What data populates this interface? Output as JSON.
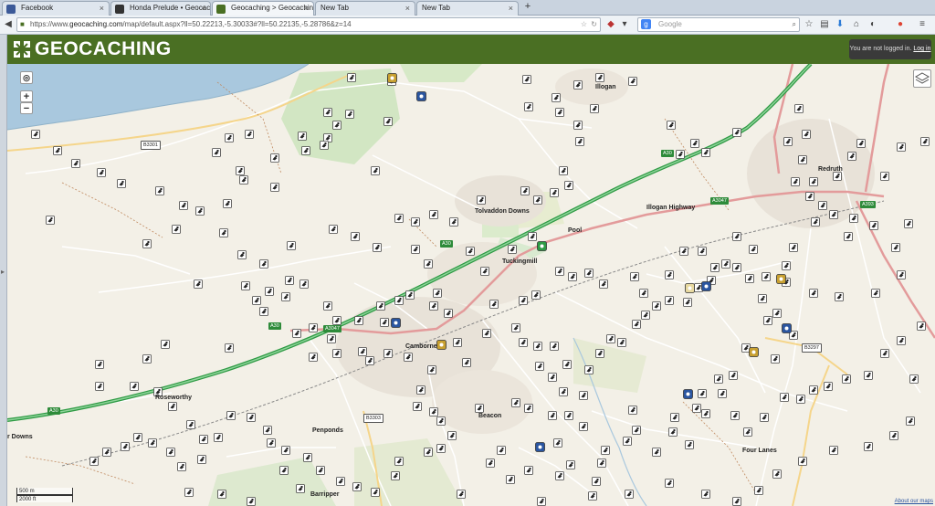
{
  "tabs": [
    {
      "label": "Facebook",
      "favicon_color": "#3b5998"
    },
    {
      "label": "Honda Prelude • Geocachi...",
      "favicon_color": "#333333"
    },
    {
      "label": "Geocaching > Geocaching ...",
      "favicon_color": "#4a6f23",
      "active": true
    },
    {
      "label": "New Tab",
      "favicon_color": ""
    },
    {
      "label": "New Tab",
      "favicon_color": ""
    }
  ],
  "toolbar": {
    "url_prefix": "https://www.",
    "url_host": "geocaching.com",
    "url_path": "/map/default.aspx?ll=50.22213,-5.30033#?ll=50.22135,-5.28786&z=14",
    "search_placeholder": "Google"
  },
  "header": {
    "brand": "GEOCACHING",
    "login_text": "You are not logged in.",
    "login_link": "Log in"
  },
  "map": {
    "zoom_in": "+",
    "zoom_out": "−",
    "place_labels": [
      {
        "text": "Illogan"
      },
      {
        "text": "Tolvaddon Downs"
      },
      {
        "text": "Pool"
      },
      {
        "text": "Tuckingmill"
      },
      {
        "text": "Illogan Highway"
      },
      {
        "text": "Camborne"
      },
      {
        "text": "Beacon"
      },
      {
        "text": "Penponds"
      },
      {
        "text": "Roseworthy"
      },
      {
        "text": "Four Lanes"
      },
      {
        "text": "Barripper"
      },
      {
        "text": "Redruth"
      },
      {
        "text": "r Downs"
      }
    ],
    "road_shields": [
      {
        "text": "B3301"
      },
      {
        "text": "A30"
      },
      {
        "text": "A30"
      },
      {
        "text": "A30"
      },
      {
        "text": "A30"
      },
      {
        "text": "A3047"
      },
      {
        "text": "A3047"
      },
      {
        "text": "A393"
      },
      {
        "text": "B3297"
      },
      {
        "text": "B3303"
      }
    ],
    "scale_metric": "500 m",
    "scale_imperial": "2000 ft",
    "attribution": "About our maps"
  }
}
